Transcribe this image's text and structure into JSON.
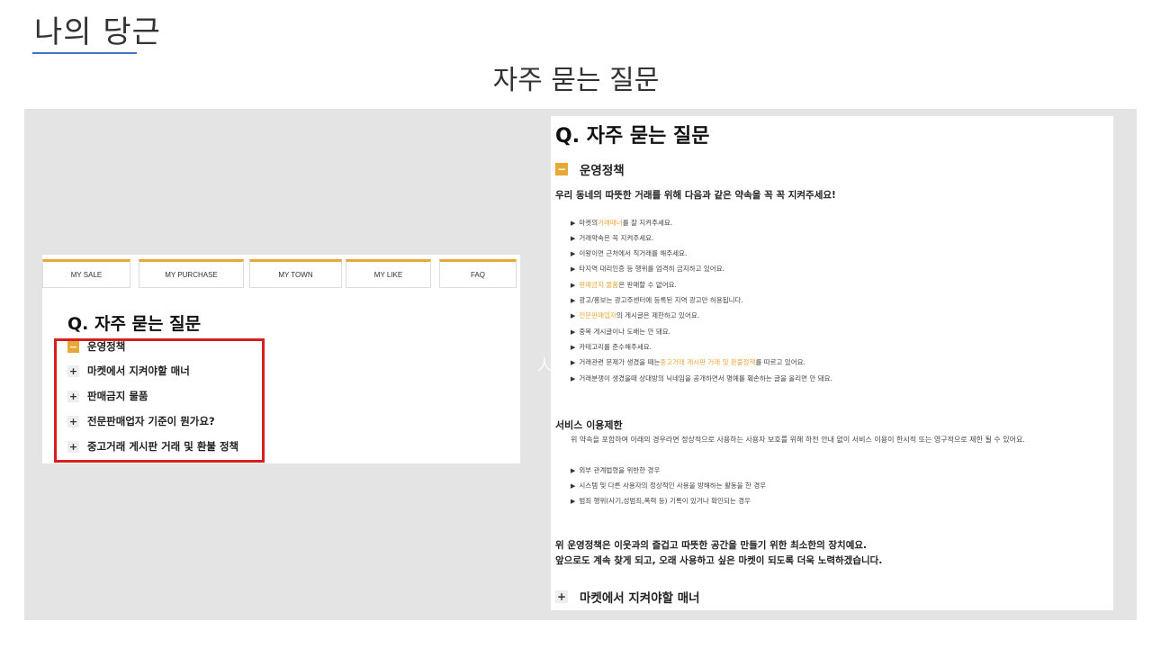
{
  "slide": {
    "title": "나의 당근",
    "subtitle": "자주 묻는 질문"
  },
  "left": {
    "tabs": [
      "MY SALE",
      "MY PURCHASE",
      "MY TOWN",
      "MY LIKE",
      "FAQ"
    ],
    "heading": "Q. 자주 묻는 질문",
    "faq": [
      {
        "label": "운영정책",
        "state": "open"
      },
      {
        "label": "마켓에서 지켜야할 매너",
        "state": "closed"
      },
      {
        "label": "판매금지 물품",
        "state": "closed"
      },
      {
        "label": "전문판매업자 기준이 뭔가요?",
        "state": "closed"
      },
      {
        "label": "중고거래 게시판 거래 및 환불 정책",
        "state": "closed"
      }
    ]
  },
  "stray": "人",
  "right": {
    "heading": "Q. 자주 묻는 질문",
    "section_open": "운영정책",
    "intro": "우리 동네의 따뜻한 거래를 위해 다음과 같은 약속을 꼭 꼭 지켜주세요!",
    "bullets": [
      {
        "pre": "마켓의 ",
        "hl": "거래매너",
        "post": "를 잘 지켜주세요."
      },
      {
        "pre": "거래약속은 꼭 지켜주세요.",
        "hl": "",
        "post": ""
      },
      {
        "pre": "이왕이면 근처에서 직거래를 해주세요.",
        "hl": "",
        "post": ""
      },
      {
        "pre": "타지역 대리인증 등 행위를 엄격히 금지하고 있어요.",
        "hl": "",
        "post": ""
      },
      {
        "pre": "",
        "hl": "판매금지 물품",
        "post": " 은 판매할 수 없어요."
      },
      {
        "pre": "광고/홍보는 광고주센터에 등록된 지역 광고만 허용됩니다.",
        "hl": "",
        "post": ""
      },
      {
        "pre": "",
        "hl": "전문판매업자",
        "post": "의 게시글은 제한하고 있어요."
      },
      {
        "pre": "중복 게시글이나 도배는 안 돼요.",
        "hl": "",
        "post": ""
      },
      {
        "pre": "카테고리를 준수해주세요.",
        "hl": "",
        "post": ""
      },
      {
        "pre": "거래관련 문제가 생겼을 때는 ",
        "hl": "중고거래 게시판 거래 및 환불정책",
        "post": "를 따르고 있어요."
      },
      {
        "pre": "거래분쟁이 생겼을때 상대방의 닉네임을 공개하면서 명예를 훼손하는 글을 올리면 안 돼요.",
        "hl": "",
        "post": ""
      }
    ],
    "service_title": "서비스 이용제한",
    "service_text": "위 약속을 포함하여 아래의 경우라면 정상적으로 사용하는 사용자 보호를 위해 하전 안내 없이 서비스 이용이 한시적 또는 영구적으로 제한 될 수 있어요.",
    "service_bullets": [
      "외부 관계법령을 위반한 경우",
      "시스템 및 다른 사용자의 정상적인 사용을 방해하는 활동을 한 경우",
      "범죄 행위(사기,성범죄,폭력 등) 기록이 있거나 확인되는 경우"
    ],
    "closing_1": "위 운영정책은 이웃과의 즐겁고 따뜻한 공간을 만들기 위한 최소한의 장치예요.",
    "closing_2": "앞으로도 계속 찾게 되고, 오래 사용하고 싶은 마켓이 되도록 더욱 노력하겠습니다.",
    "section_closed": "마켓에서 지켜야할 매너"
  },
  "icons": {
    "open": "minus-icon",
    "closed": "plus-icon"
  },
  "colors": {
    "accent": "#e8a838",
    "highlight_box": "#d91e1e",
    "title_underline": "#4472c4",
    "panel": "#e4e4e4"
  }
}
